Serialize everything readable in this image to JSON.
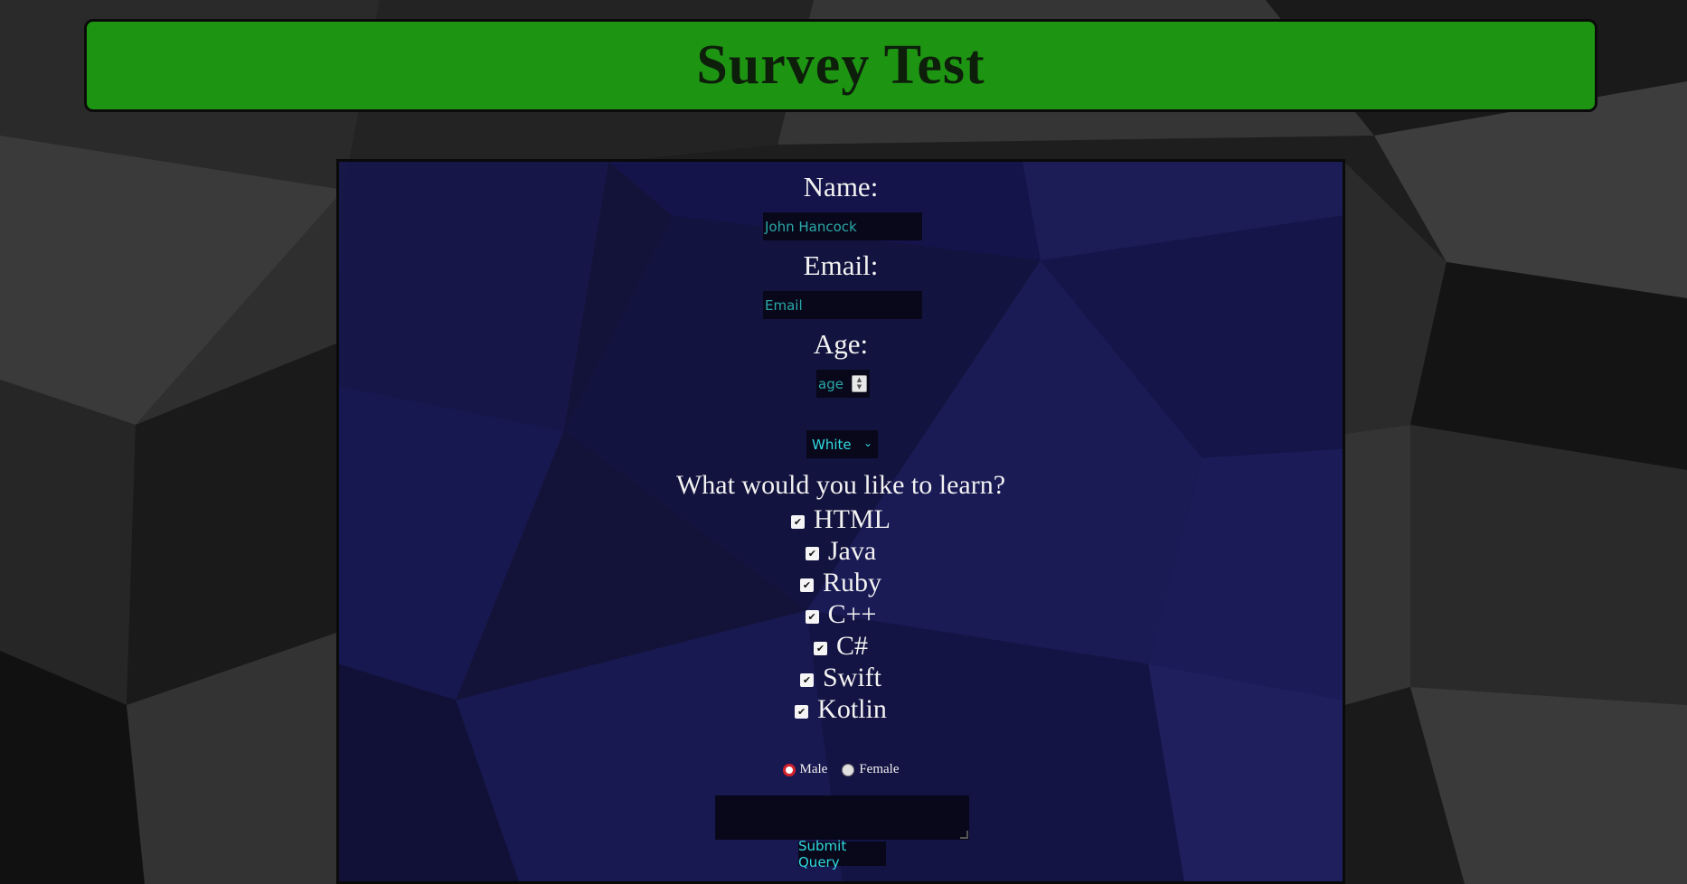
{
  "page": {
    "title": "Survey Test"
  },
  "form": {
    "name_label": "Name:",
    "name_value": "John Hancock",
    "email_label": "Email:",
    "email_placeholder": "Email",
    "age_label": "Age:",
    "age_placeholder": "age",
    "race_selected": "White",
    "learn_question": "What would you like to learn?",
    "learn_options": [
      {
        "label": "HTML",
        "checked": true
      },
      {
        "label": "Java",
        "checked": true
      },
      {
        "label": "Ruby",
        "checked": true
      },
      {
        "label": "C++",
        "checked": true
      },
      {
        "label": "C#",
        "checked": true
      },
      {
        "label": "Swift",
        "checked": true
      },
      {
        "label": "Kotlin",
        "checked": true
      }
    ],
    "gender_options": [
      {
        "label": "Male",
        "selected": true
      },
      {
        "label": "Female",
        "selected": false
      }
    ],
    "comments_value": "",
    "submit_label": "Submit Query"
  },
  "colors": {
    "header_green": "#1e9512",
    "panel_navy": "#12123c",
    "input_text": "#2aa9a9",
    "accent_cyan": "#31d9e0",
    "radio_red": "#d4202a"
  },
  "icons": {
    "checkbox": "checkmark-icon",
    "select": "chevron-down-icon",
    "number": "spinner-arrows-icon"
  }
}
